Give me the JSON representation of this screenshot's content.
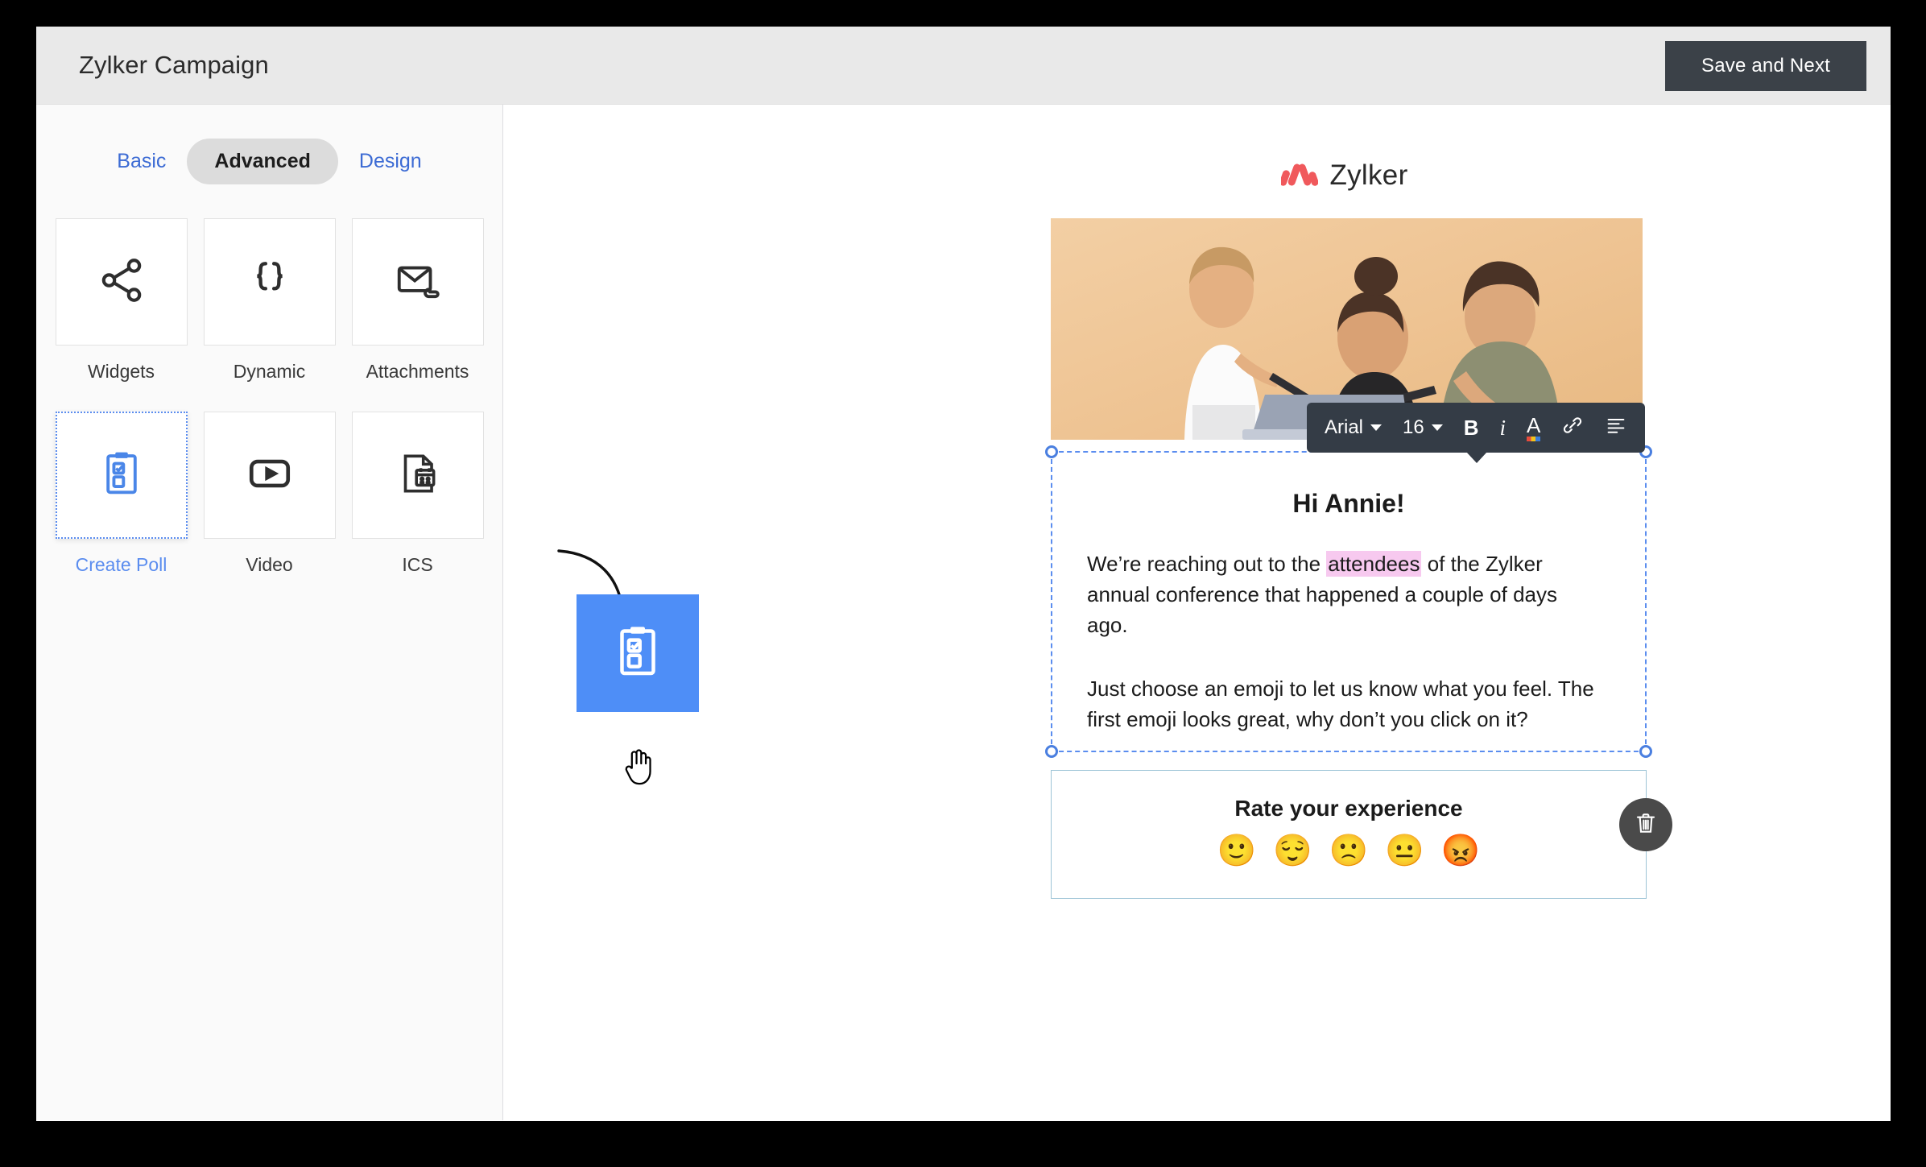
{
  "header": {
    "title": "Zylker Campaign",
    "save_label": "Save and Next"
  },
  "sidebar": {
    "tabs": [
      {
        "label": "Basic",
        "active": false
      },
      {
        "label": "Advanced",
        "active": true
      },
      {
        "label": "Design",
        "active": false
      }
    ],
    "widgets": [
      {
        "label": "Widgets",
        "icon": "share-icon",
        "selected": false
      },
      {
        "label": "Dynamic",
        "icon": "curly-braces-icon",
        "selected": false
      },
      {
        "label": "Attachments",
        "icon": "envelope-attachment-icon",
        "selected": false
      },
      {
        "label": "Create Poll",
        "icon": "clipboard-checklist-icon",
        "selected": true
      },
      {
        "label": "Video",
        "icon": "play-button-icon",
        "selected": false
      },
      {
        "label": "ICS",
        "icon": "calendar-document-icon",
        "selected": false
      }
    ]
  },
  "canvas": {
    "drag_ghost": {
      "icon": "clipboard-checklist-icon",
      "color": "#4e8ef7"
    },
    "cursor": "hand-pointer-cursor"
  },
  "email": {
    "brand_name": "Zylker",
    "brand_color": "#f0595c",
    "hero_alt": "three colleagues looking at a laptop",
    "greeting": "Hi Annie!",
    "paragraph1_before": "We’re reaching out to the ",
    "paragraph1_highlight": "attendees",
    "paragraph1_after": " of the Zylker annual conference that happened a couple of days ago.",
    "paragraph2": "Just choose an emoji to let us know what you feel. The first emoji looks great, why don’t you click on it?",
    "highlight_color": "#f7c9ef"
  },
  "toolbar": {
    "font_family": "Arial",
    "font_size": "16",
    "bold": "B",
    "italic": "i",
    "text_color": "A",
    "link": "link-icon",
    "align": "align-left-icon"
  },
  "poll": {
    "title": "Rate your experience",
    "emojis": [
      "🙂",
      "😌",
      "🙁",
      "😐",
      "😡"
    ],
    "delete_label": "trash-icon"
  }
}
